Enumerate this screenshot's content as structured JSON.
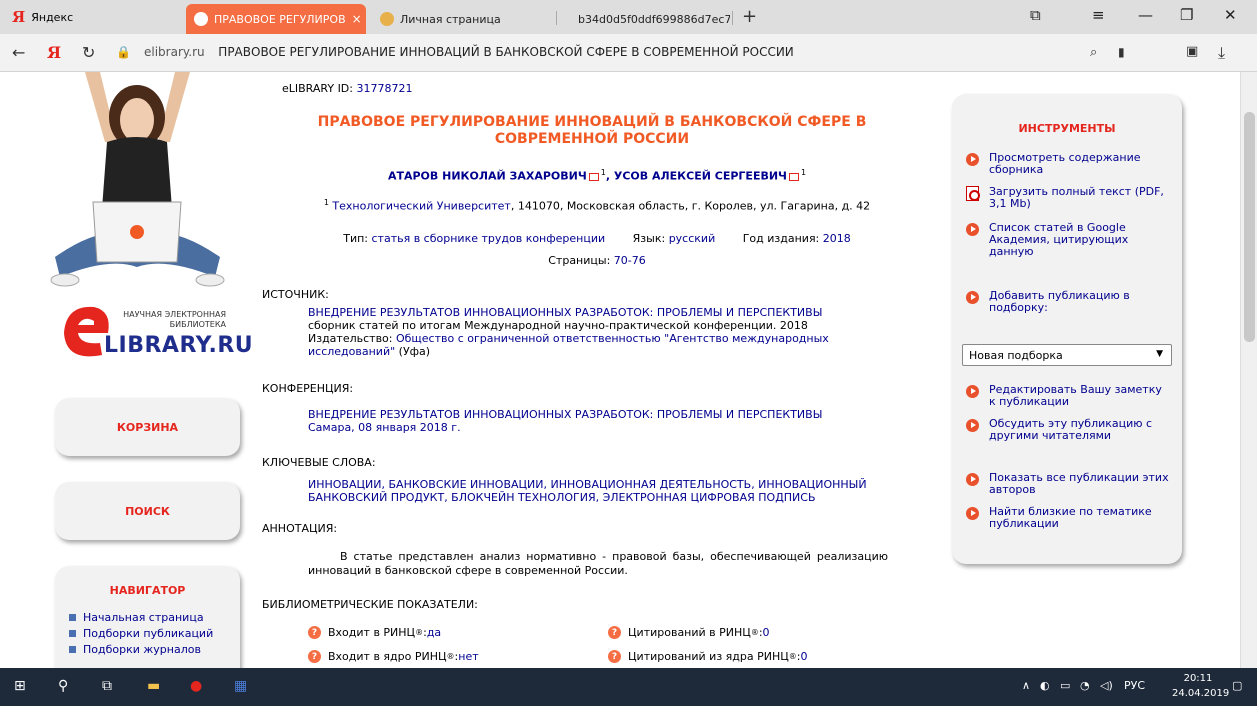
{
  "browser": {
    "yandex_tab": "Яндекс",
    "tabs": [
      {
        "label": "ПРАВОВОЕ РЕГУЛИРОВ",
        "close": "×"
      },
      {
        "label": "Личная страница"
      },
      {
        "label": "b34d0d5f0ddf699886d7ec7"
      }
    ],
    "new_tab": "+",
    "domain": "elibrary.ru",
    "page_title": "ПРАВОВОЕ РЕГУЛИРОВАНИЕ ИННОВАЦИЙ В БАНКОВСКОЙ СФЕРЕ В СОВРЕМЕННОЙ РОССИИ"
  },
  "sidebar": {
    "logo_small": "НАУЧНАЯ ЭЛЕКТРОННАЯ БИБЛИОТЕКА",
    "logo_big": "LIBRARY.RU",
    "cart": "КОРЗИНА",
    "search": "ПОИСК",
    "navigator": "НАВИГАТОР",
    "nav_items": [
      "Начальная страница",
      "Подборки публикаций",
      "Подборки журналов"
    ]
  },
  "article": {
    "id_label": "eLIBRARY ID: ",
    "id_value": "31778721",
    "title": "ПРАВОВОЕ РЕГУЛИРОВАНИЕ ИННОВАЦИЙ В БАНКОВСКОЙ СФЕРЕ В СОВРЕМЕННОЙ РОССИИ",
    "author1": "АТАРОВ НИКОЛАЙ ЗАХАРОВИЧ",
    "author2": "УСОВ АЛЕКСЕЙ СЕРГЕЕВИЧ",
    "sup": "1",
    "sep": ", ",
    "affil_org": "Технологический Университет",
    "affil_rest": ", 141070, Московская область, г. Королев, ул. Гагарина, д. 42",
    "type_label": "Тип: ",
    "type_value": "статья в сборнике трудов конференции",
    "lang_label": "Язык: ",
    "lang_value": "русский",
    "year_label": "Год издания: ",
    "year_value": "2018",
    "pages_label": "Страницы: ",
    "pages_value": "70-76",
    "source_h": "ИСТОЧНИК:",
    "source_title": "ВНЕДРЕНИЕ РЕЗУЛЬТАТОВ ИННОВАЦИОННЫХ РАЗРАБОТОК: ПРОБЛЕМЫ И ПЕРСПЕКТИВЫ",
    "source_desc": "сборник статей по итогам Международной научно-практической конференции. 2018",
    "publisher_label": "Издательство: ",
    "publisher_value": "Общество с ограниченной ответственностью \"Агентство международных исследований\"",
    "publisher_city": " (Уфа)",
    "conf_h": "КОНФЕРЕНЦИЯ:",
    "conf_title": "ВНЕДРЕНИЕ РЕЗУЛЬТАТОВ ИННОВАЦИОННЫХ РАЗРАБОТОК: ПРОБЛЕМЫ И ПЕРСПЕКТИВЫ",
    "conf_place": "Самара, 08 января 2018 г.",
    "kw_h": "КЛЮЧЕВЫЕ СЛОВА:",
    "keywords": "ИННОВАЦИИ, БАНКОВСКИЕ ИННОВАЦИИ, ИННОВАЦИОННАЯ ДЕЯТЕЛЬНОСТЬ, ИННОВАЦИОННЫЙ БАНКОВСКИЙ ПРОДУКТ, БЛОКЧЕЙН ТЕХНОЛОГИЯ, ЭЛЕКТРОННАЯ ЦИФРОВАЯ ПОДПИСЬ",
    "annot_h": "АННОТАЦИЯ:",
    "annotation": "В статье представлен анализ нормативно - правовой базы, обеспечивающей реализацию инноваций в банковской сфере в современной России.",
    "biblio_h": "БИБЛИОМЕТРИЧЕСКИЕ ПОКАЗАТЕЛИ:",
    "m1_label": "Входит в РИНЦ",
    "m1_value": "да",
    "m2_label": "Входит в ядро РИНЦ",
    "m2_value": "нет",
    "m3_label": "Цитирований в РИНЦ",
    "m3_value": "0",
    "m4_label": "Цитирований из ядра РИНЦ",
    "m4_value": "0",
    "reg": "®",
    "colon": ": "
  },
  "tools": {
    "title": "ИНСТРУМЕНТЫ",
    "t1": "Просмотреть содержание сборника",
    "t2": "Загрузить полный текст (PDF, 3,1 Mb)",
    "t3": "Список статей в Google Академия, цитирующих данную",
    "t4": "Добавить публикацию в подборку:",
    "select_value": "Новая подборка",
    "t5": "Редактировать Вашу заметку к публикации",
    "t6": "Обсудить эту публикацию с другими читателями",
    "t7": "Показать все публикации этих авторов",
    "t8": "Найти близкие по тематике публикации"
  },
  "taskbar": {
    "lang": "РУС",
    "time": "20:11",
    "date": "24.04.2019"
  },
  "colors": {
    "accent": "#f15a24",
    "link": "#00008f",
    "panel": "#f2f2f2"
  }
}
